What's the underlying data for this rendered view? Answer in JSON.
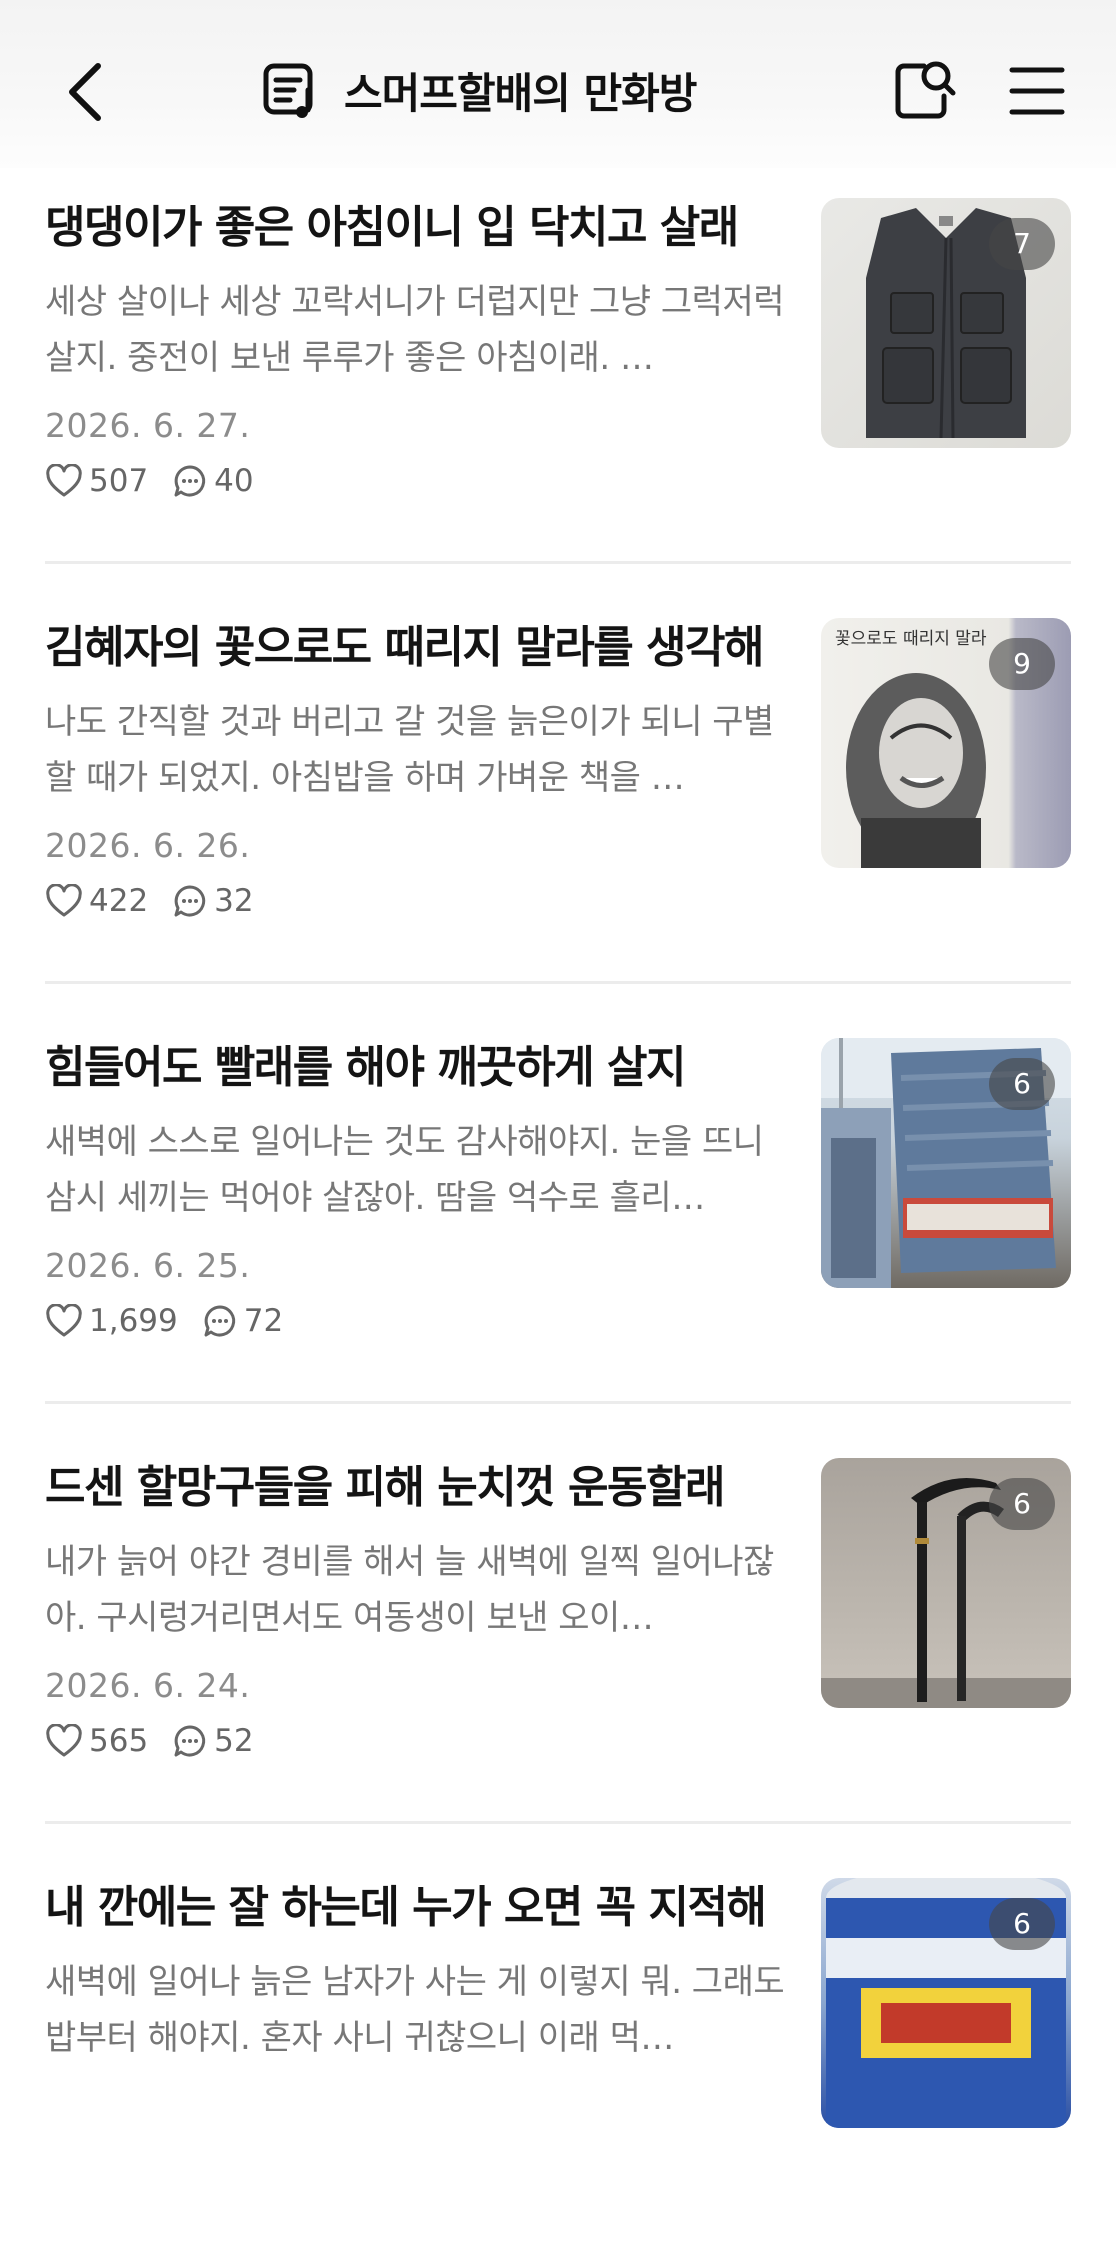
{
  "header": {
    "title": "스머프할배의 만화방",
    "icons": {
      "back": "back-chevron-icon",
      "board": "board-list-icon",
      "search": "search-icon",
      "menu": "hamburger-menu-icon"
    }
  },
  "posts": [
    {
      "title": "댕댕이가 좋은 아침이니 입 닥치고 살래",
      "excerpt": "세상 살이나 세상 꼬락서니가 더럽지만 그냥 그럭저럭 살지. 중전이 보낸 루루가 좋은 아침이래. …",
      "date": "2026. 6. 27.",
      "likes": "507",
      "comments": "40",
      "image_count": "7",
      "thumb": "vest-photo"
    },
    {
      "title": "김혜자의 꽃으로도 때리지 말라를 생각해",
      "excerpt": "나도 간직할 것과 버리고 갈 것을 늙은이가 되니 구별할 때가 되었지. 아침밥을 하며 가벼운 책을 …",
      "date": "2026. 6. 26.",
      "likes": "422",
      "comments": "32",
      "image_count": "9",
      "thumb": "book-cover-photo",
      "thumb_text": "꽃으로도 때리지 말라"
    },
    {
      "title": "힘들어도 빨래를 해야 깨끗하게 살지",
      "excerpt": "새벽에 스스로 일어나는 것도 감사해야지. 눈을 뜨니 삼시 세끼는 먹어야 살잖아. 땀을 억수로 흘리…",
      "date": "2026. 6. 25.",
      "likes": "1,699",
      "comments": "72",
      "image_count": "6",
      "thumb": "towel-laundry-photo"
    },
    {
      "title": "드센 할망구들을 피해 눈치껏 운동할래",
      "excerpt": "내가 늙어 야간 경비를 해서 늘 새벽에 일찍 일어나잖아. 구시렁거리면서도 여동생이 보낸 오이…",
      "date": "2026. 6. 24.",
      "likes": "565",
      "comments": "52",
      "image_count": "6",
      "thumb": "walking-cane-photo"
    },
    {
      "title": "내 깐에는 잘 하는데 누가 오면 꼭 지적해",
      "excerpt": "새벽에 일어나 늙은 남자가 사는 게 이렇지 뭐. 그래도 밥부터 해야지. 혼자 사니 귀찮으니 이래 먹…",
      "date": "",
      "likes": "",
      "comments": "",
      "image_count": "6",
      "thumb": "detergent-bottle-photo"
    }
  ]
}
